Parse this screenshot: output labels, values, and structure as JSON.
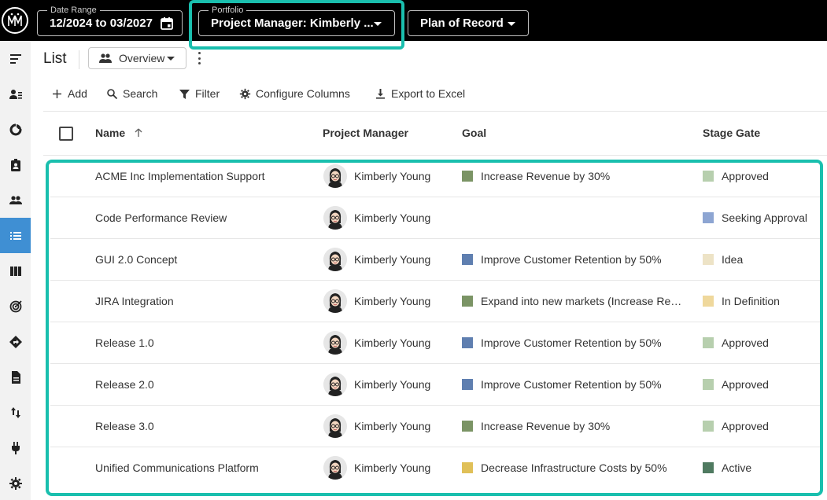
{
  "topbar": {
    "date_range": {
      "label": "Date Range",
      "value": "12/2024 to 03/2027"
    },
    "portfolio": {
      "label": "Portfolio",
      "value": "Project Manager: Kimberly ..."
    },
    "plan": {
      "value": "Plan of Record"
    }
  },
  "header": {
    "title": "List",
    "view": "Overview"
  },
  "toolbar": {
    "add": "Add",
    "search": "Search",
    "filter": "Filter",
    "configure": "Configure Columns",
    "export": "Export to Excel"
  },
  "table": {
    "columns": [
      "Name",
      "Project Manager",
      "Goal",
      "Stage Gate"
    ],
    "rows": [
      {
        "name": "ACME Inc Implementation Support",
        "manager": "Kimberly Young",
        "goal": "Increase Revenue by 30%",
        "goal_color": "#7b9465",
        "stage": "Approved",
        "stage_color": "#b7cfae"
      },
      {
        "name": "Code Performance Review",
        "manager": "Kimberly Young",
        "goal": "",
        "goal_color": "",
        "stage": "Seeking Approval",
        "stage_color": "#8da5d2"
      },
      {
        "name": "GUI 2.0 Concept",
        "manager": "Kimberly Young",
        "goal": "Improve Customer Retention by 50%",
        "goal_color": "#5f7fb0",
        "stage": "Idea",
        "stage_color": "#ede3c6"
      },
      {
        "name": "JIRA Integration",
        "manager": "Kimberly Young",
        "goal": "Expand into new markets (Increase Re…",
        "goal_color": "#7b9465",
        "stage": "In Definition",
        "stage_color": "#efd89c"
      },
      {
        "name": "Release 1.0",
        "manager": "Kimberly Young",
        "goal": "Improve Customer Retention by 50%",
        "goal_color": "#5f7fb0",
        "stage": "Approved",
        "stage_color": "#b7cfae"
      },
      {
        "name": "Release 2.0",
        "manager": "Kimberly Young",
        "goal": "Improve Customer Retention by 50%",
        "goal_color": "#5f7fb0",
        "stage": "Approved",
        "stage_color": "#b7cfae"
      },
      {
        "name": "Release 3.0",
        "manager": "Kimberly Young",
        "goal": "Increase Revenue by 30%",
        "goal_color": "#7b9465",
        "stage": "Approved",
        "stage_color": "#b7cfae"
      },
      {
        "name": "Unified Communications Platform",
        "manager": "Kimberly Young",
        "goal": "Decrease Infrastructure Costs by 50%",
        "goal_color": "#e0c058",
        "stage": "Active",
        "stage_color": "#4f7a60"
      }
    ]
  },
  "sidebar": {
    "items": [
      {
        "icon": "menu-collapse-icon"
      },
      {
        "icon": "user-list-icon"
      },
      {
        "icon": "donut-chart-icon"
      },
      {
        "icon": "clipboard-user-icon"
      },
      {
        "icon": "people-icon"
      },
      {
        "icon": "list-icon",
        "active": true
      },
      {
        "icon": "board-columns-icon"
      },
      {
        "icon": "target-icon"
      },
      {
        "icon": "directions-icon"
      },
      {
        "icon": "document-icon"
      },
      {
        "icon": "swap-vertical-icon"
      },
      {
        "icon": "plug-icon"
      },
      {
        "icon": "gear-icon"
      }
    ]
  },
  "colors": {
    "accent_highlight": "#1abfae",
    "sidebar_active": "#3f8fd3"
  }
}
